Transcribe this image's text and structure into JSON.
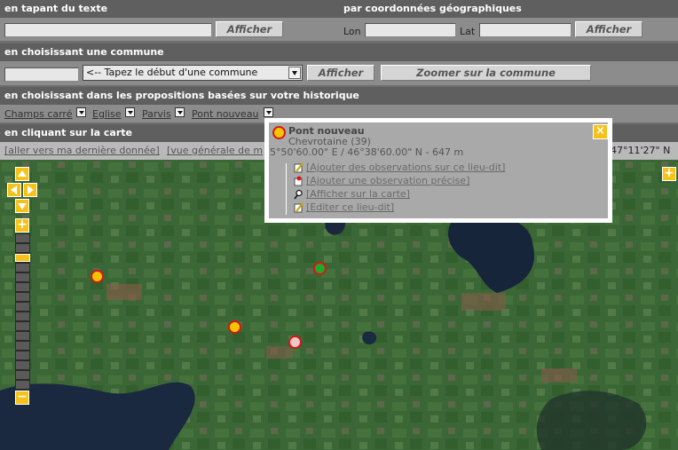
{
  "search_text": {
    "heading": "en tapant du texte",
    "input_value": "",
    "button_label": "Afficher"
  },
  "search_coords": {
    "heading": "par coordonnées géographiques",
    "lon_label": "Lon",
    "lon_value": "",
    "lat_label": "Lat",
    "lat_value": "",
    "button_label": "Afficher"
  },
  "commune": {
    "heading": "en choisissant une commune",
    "input_value": "",
    "select_value": "<-- Tapez le début d'une commune",
    "show_button": "Afficher",
    "zoom_button": "Zoomer sur la commune"
  },
  "history": {
    "heading": "en choisissant dans les propositions basées sur votre historique",
    "items": [
      {
        "label": "Champs carré"
      },
      {
        "label": "Eglise"
      },
      {
        "label": "Parvis"
      },
      {
        "label": "Pont nouveau"
      }
    ]
  },
  "map_click": {
    "heading": "en cliquant sur la carte",
    "link_last": "[aller vers ma dernière donnée]",
    "link_overview": "[vue générale de m",
    "coord_readout": "47°11'27\" N"
  },
  "map_controls": {
    "pan_up_icon": "arrow-up-icon",
    "pan_left_icon": "arrow-left-icon",
    "pan_right_icon": "arrow-right-icon",
    "pan_down_icon": "arrow-down-icon",
    "zoom_in": "+",
    "zoom_out": "−",
    "expand": "+",
    "zoom_level_fraction": 0.12
  },
  "popup": {
    "title": "Pont nouveau",
    "subtitle": "Chevrotaine (39)",
    "coordinates": "5°50'60.00\" E / 46°38'60.00\" N - 647 m",
    "close_label": "×",
    "actions": [
      {
        "label": "[Ajouter des observations sur ce lieu-dit]",
        "icon": "edit-note-icon"
      },
      {
        "label": "[Ajouter une observation précise]",
        "icon": "pin-note-icon"
      },
      {
        "label": "[Afficher sur la carte]",
        "icon": "magnifier-icon"
      },
      {
        "label": "[Editer ce lieu-dit]",
        "icon": "pencil-icon"
      }
    ]
  },
  "markers": [
    {
      "name": "marker-yellow-1",
      "fill": "#f5c400"
    },
    {
      "name": "marker-green",
      "fill": "#22a82a"
    },
    {
      "name": "marker-yellow-2",
      "fill": "#f5c400"
    },
    {
      "name": "marker-pink",
      "fill": "#f0c6c6"
    }
  ],
  "colors": {
    "header": "#5f5f5f",
    "row": "#8c8c8c",
    "accent": "#f6c21a",
    "marker_border": "#d21818"
  }
}
